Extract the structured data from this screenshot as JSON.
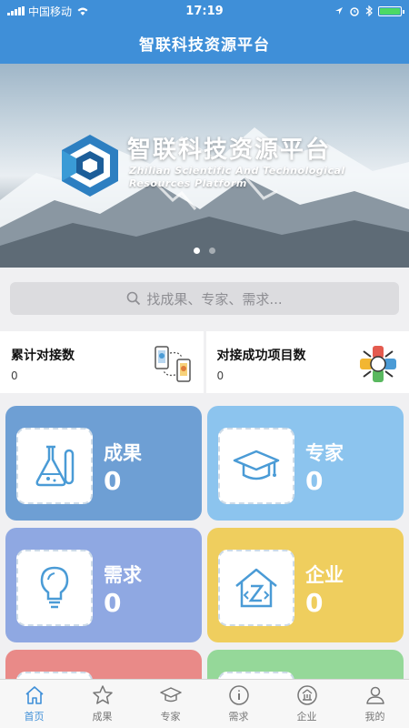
{
  "status": {
    "carrier": "中国移动",
    "time": "17:19"
  },
  "nav": {
    "title": "智联科技资源平台"
  },
  "banner": {
    "title": "智联科技资源平台",
    "subtitle_line1": "Zhilian Scientific And Technological",
    "subtitle_line2": "Resources Platform",
    "slides_total": 2,
    "slide_active": 1
  },
  "search": {
    "placeholder": "找成果、专家、需求..."
  },
  "stats": [
    {
      "label": "累计对接数",
      "value": "0",
      "icon": "phone-exchange-icon"
    },
    {
      "label": "对接成功项目数",
      "value": "0",
      "icon": "hands-team-icon"
    }
  ],
  "cards": [
    {
      "label": "成果",
      "count": "0",
      "icon": "lab-flask-icon",
      "color": "#6e9fd4"
    },
    {
      "label": "专家",
      "count": "0",
      "icon": "graduation-cap-icon",
      "color": "#8cc4ee"
    },
    {
      "label": "需求",
      "count": "0",
      "icon": "lightbulb-icon",
      "color": "#8fa8e2"
    },
    {
      "label": "企业",
      "count": "0",
      "icon": "company-house-icon",
      "color": "#efce5e"
    },
    {
      "label": "",
      "count": "",
      "icon": "",
      "color": "#e98a88"
    },
    {
      "label": "",
      "count": "",
      "icon": "",
      "color": "#95d899"
    }
  ],
  "tabs": [
    {
      "label": "首页",
      "icon": "home-icon",
      "active": true
    },
    {
      "label": "成果",
      "icon": "star-icon",
      "active": false
    },
    {
      "label": "专家",
      "icon": "graduation-cap-icon",
      "active": false
    },
    {
      "label": "需求",
      "icon": "info-icon",
      "active": false
    },
    {
      "label": "企业",
      "icon": "company-icon",
      "active": false
    },
    {
      "label": "我的",
      "icon": "user-icon",
      "active": false
    }
  ],
  "colors": {
    "primary": "#3f8fd8",
    "icon_blue": "#4a9bd6"
  }
}
